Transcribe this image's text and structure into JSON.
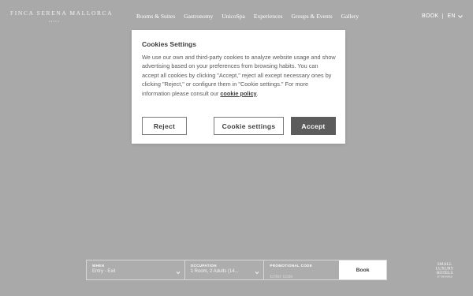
{
  "header": {
    "logo": {
      "name": "FINCA SERENA MALLORCA",
      "stars": "•••••"
    },
    "nav": [
      {
        "label": "Rooms & Suites"
      },
      {
        "label": "Gastronomy"
      },
      {
        "label": "UnicoSpa"
      },
      {
        "label": "Experiences"
      },
      {
        "label": "Groups & Events"
      },
      {
        "label": "Gallery"
      }
    ],
    "book_label": "BOOK",
    "language": "EN",
    "icons": {
      "language_dropdown": "chevron-down-icon"
    }
  },
  "cookie_dialog": {
    "title": "Cookies Settings",
    "body": "We use our own and third-party cookies to analyze website usage and show advertising based on your preferences from browsing habits. You can accept all cookies by clicking \"Accept,\" reject all except necessary ones by clicking \"Reject,\" or configure them in \"Cookie settings.\" For more information please consult our ",
    "link_text": "cookie policy",
    "link_suffix": ".",
    "buttons": {
      "reject": "Reject",
      "settings": "Cookie settings",
      "accept": "Accept"
    }
  },
  "booking_bar": {
    "when": {
      "label": "WHEN",
      "value": "Entry - Exit"
    },
    "occupation": {
      "label": "OCCUPATION",
      "value": "1 Room, 2 Adults (14..."
    },
    "promo": {
      "label": "PROMOTIONAL CODE",
      "placeholder": "Enter code"
    },
    "book_button": "Book"
  },
  "badge": {
    "lines": [
      "SMALL",
      "LUXURY",
      "HOTELS",
      "OF THE WORLD"
    ]
  },
  "colors": {
    "overlay": "#a9a9a9",
    "dialog_bg": "#ffffff",
    "accept_bg": "#5c5c5c",
    "text_dark": "#3d3d3d"
  }
}
